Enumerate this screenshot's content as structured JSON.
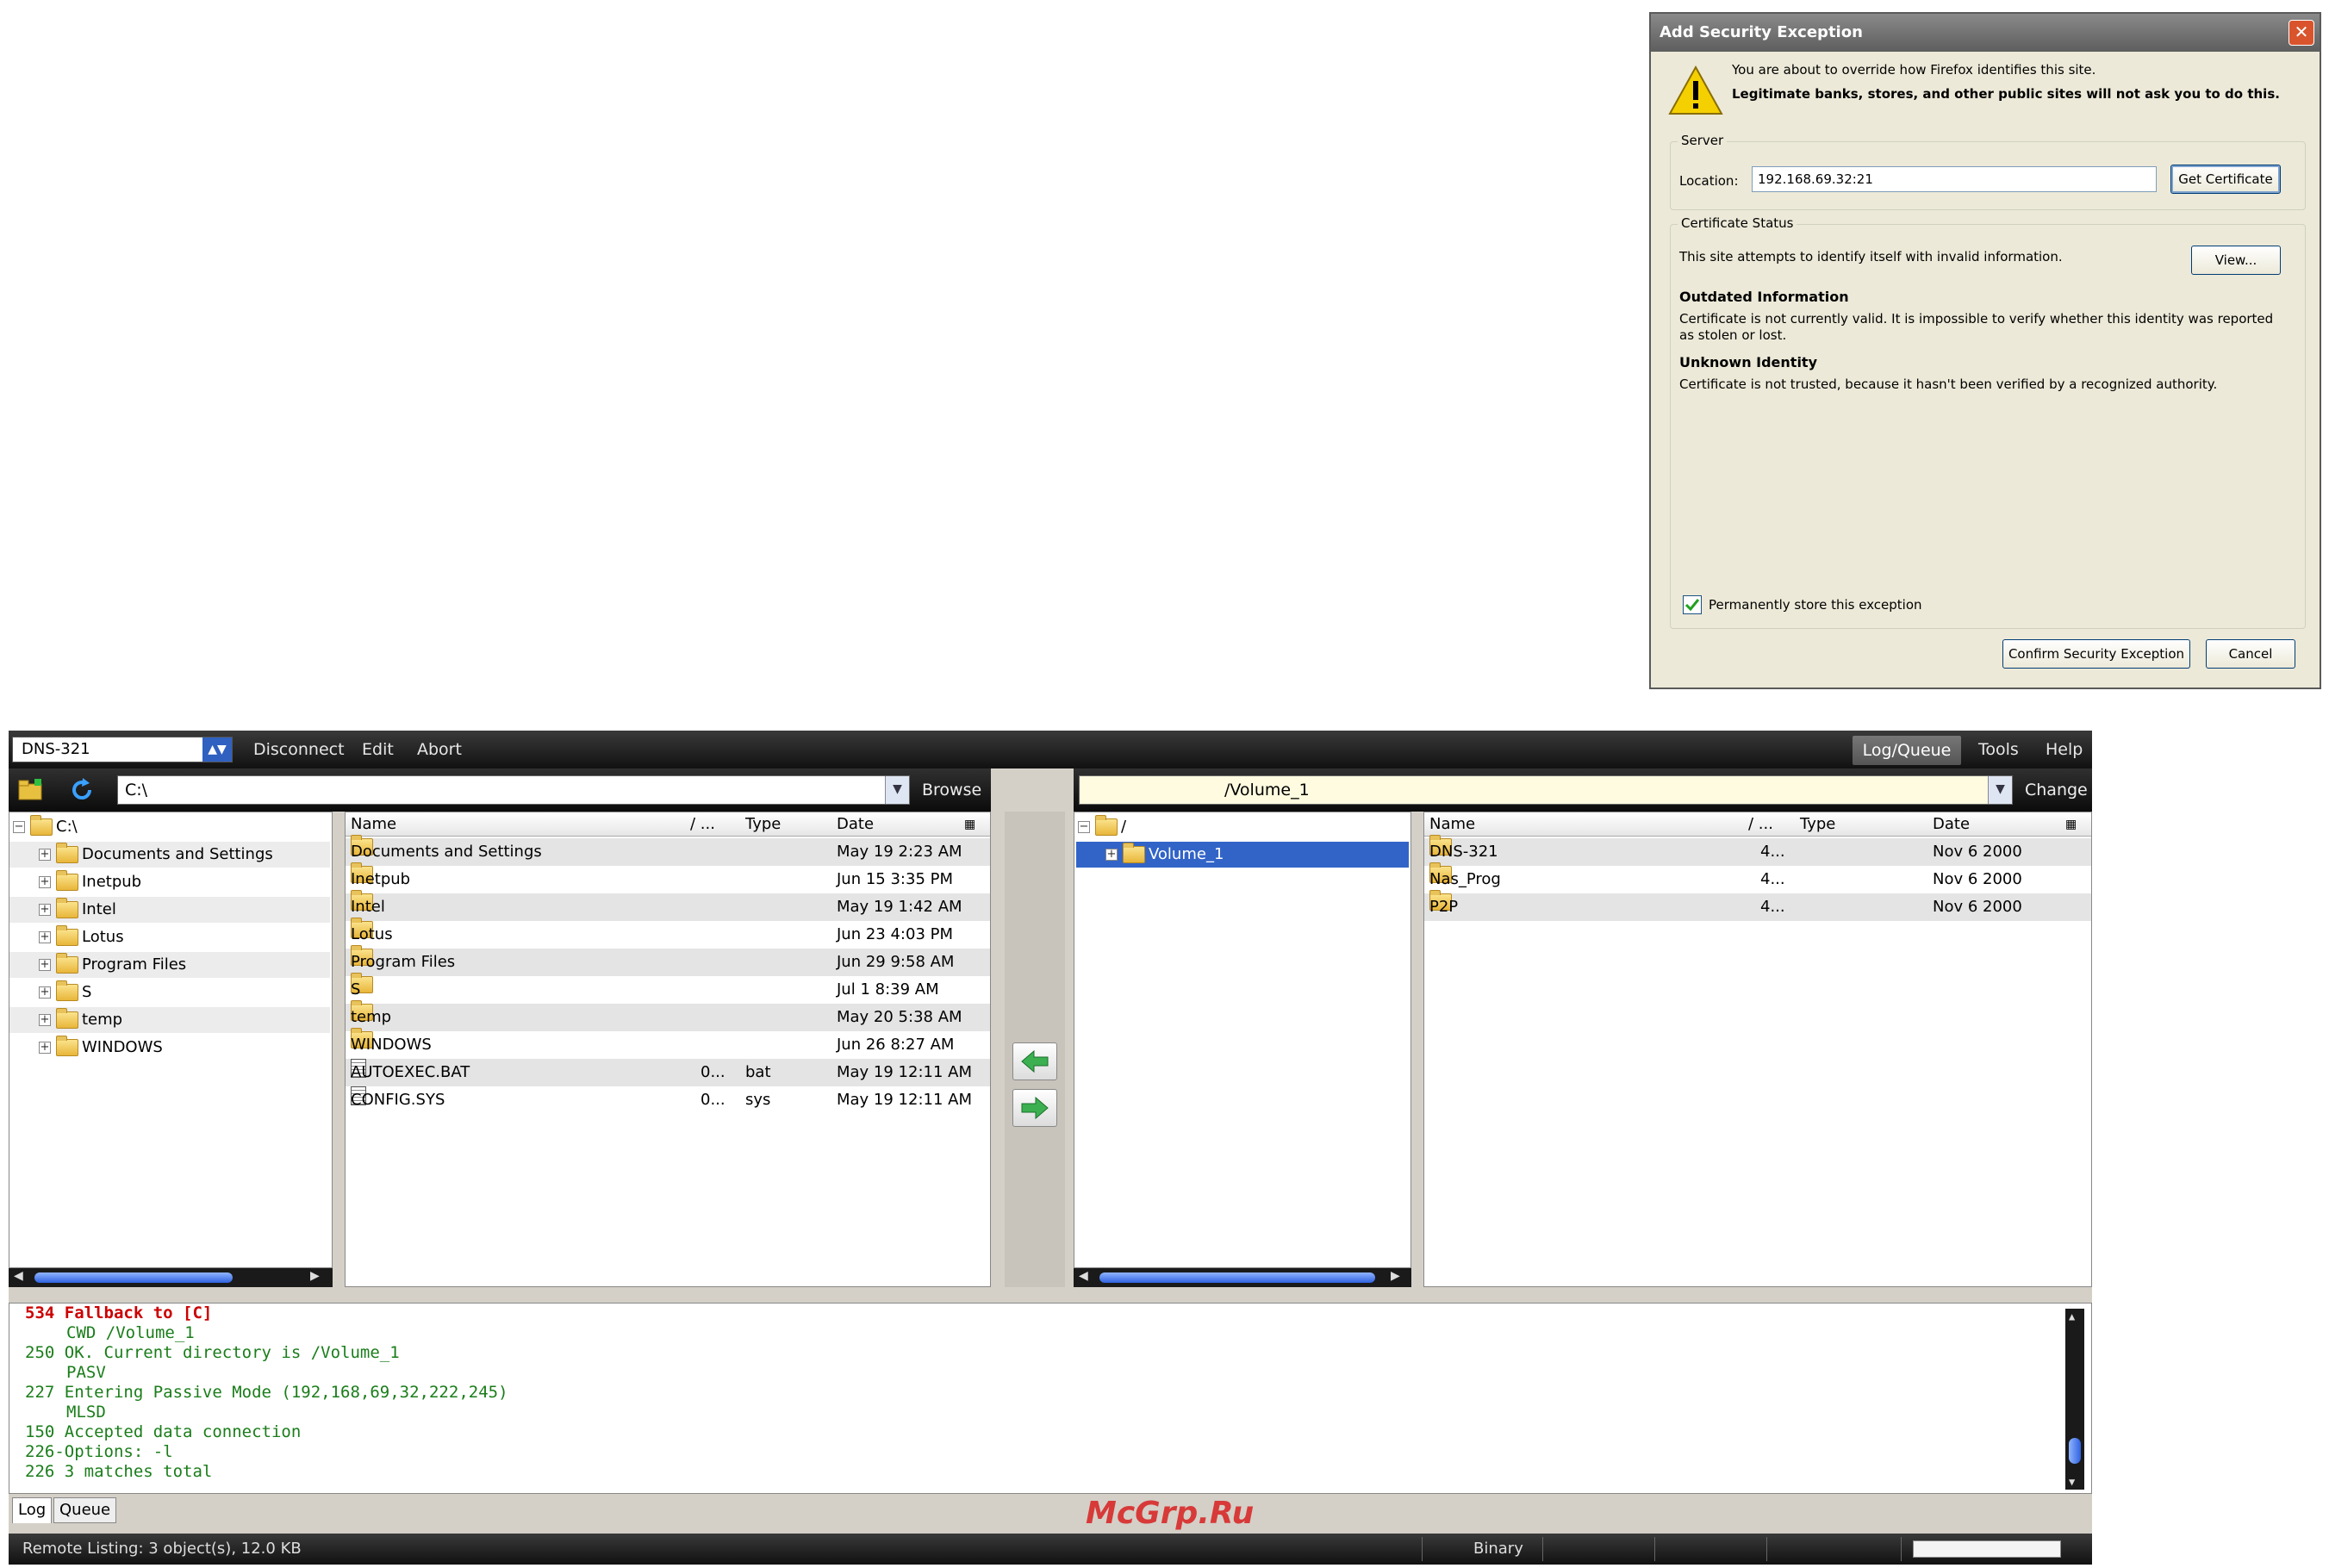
{
  "dialog": {
    "title": "Add Security Exception",
    "intro": "You are about to override how Firefox identifies this site.",
    "warning": "Legitimate banks, stores, and other public sites will not ask you to do this.",
    "server_group": "Server",
    "location_label": "Location:",
    "location_value": "192.168.69.32:21",
    "get_certificate": "Get Certificate",
    "cert_group": "Certificate Status",
    "cert_intro": "This site attempts to identify itself with invalid information.",
    "view_button": "View...",
    "outdated_title": "Outdated Information",
    "outdated_text": "Certificate is not currently valid. It is impossible to verify whether this identity was reported as stolen or lost.",
    "unknown_title": "Unknown Identity",
    "unknown_text": "Certificate is not trusted, because it hasn't been verified by a recognized authority.",
    "permanent_label": "Permanently store this exception",
    "confirm_button": "Confirm Security Exception",
    "cancel_button": "Cancel",
    "colors": {
      "titlebar": "#6e6e6e",
      "close": "#d9542c",
      "body": "#ece9d8"
    }
  },
  "app": {
    "connection": "DNS-321",
    "menu": [
      "Disconnect",
      "Edit",
      "Abort"
    ],
    "right_menu": {
      "active": "Log/Queue",
      "tools": "Tools",
      "help": "Help"
    },
    "local": {
      "path": "C:\\",
      "browse": "Browse",
      "tree_root": "C:\\",
      "tree": [
        "Documents and Settings",
        "Inetpub",
        "Intel",
        "Lotus",
        "Program Files",
        "S",
        "temp",
        "WINDOWS"
      ],
      "columns": {
        "name": "Name",
        "size": "/ ...",
        "type": "Type",
        "date": "Date"
      },
      "files": [
        {
          "name": "Documents and Settings",
          "size": "",
          "type": "",
          "date": "May 19 2:23 AM",
          "kind": "folder"
        },
        {
          "name": "Inetpub",
          "size": "",
          "type": "",
          "date": "Jun 15 3:35 PM",
          "kind": "folder"
        },
        {
          "name": "Intel",
          "size": "",
          "type": "",
          "date": "May 19 1:42 AM",
          "kind": "folder"
        },
        {
          "name": "Lotus",
          "size": "",
          "type": "",
          "date": "Jun 23 4:03 PM",
          "kind": "folder"
        },
        {
          "name": "Program Files",
          "size": "",
          "type": "",
          "date": "Jun 29 9:58 AM",
          "kind": "folder"
        },
        {
          "name": "S",
          "size": "",
          "type": "",
          "date": "Jul 1 8:39 AM",
          "kind": "folder"
        },
        {
          "name": "temp",
          "size": "",
          "type": "",
          "date": "May 20 5:38 AM",
          "kind": "folder"
        },
        {
          "name": "WINDOWS",
          "size": "",
          "type": "",
          "date": "Jun 26 8:27 AM",
          "kind": "folder"
        },
        {
          "name": "AUTOEXEC.BAT",
          "size": "0...",
          "type": "bat",
          "date": "May 19 12:11 AM",
          "kind": "file"
        },
        {
          "name": "CONFIG.SYS",
          "size": "0...",
          "type": "sys",
          "date": "May 19 12:11 AM",
          "kind": "file"
        }
      ]
    },
    "remote": {
      "path": "/Volume_1",
      "change": "Change",
      "tree_root": "/",
      "tree": [
        "Volume_1"
      ],
      "columns": {
        "name": "Name",
        "size": "/ ...",
        "type": "Type",
        "date": "Date"
      },
      "files": [
        {
          "name": "DNS-321",
          "size": "4...",
          "type": "",
          "date": "Nov 6 2000"
        },
        {
          "name": "Nas_Prog",
          "size": "4...",
          "type": "",
          "date": "Nov 6 2000"
        },
        {
          "name": "P2P",
          "size": "4...",
          "type": "",
          "date": "Nov 6 2000"
        }
      ]
    },
    "log": [
      {
        "text": "534 Fallback to [C]",
        "kind": "err"
      },
      {
        "text": "CWD /Volume_1",
        "kind": "cmd"
      },
      {
        "text": "250 OK. Current directory is /Volume_1",
        "kind": "resp"
      },
      {
        "text": "PASV",
        "kind": "cmd"
      },
      {
        "text": "227 Entering Passive Mode (192,168,69,32,222,245)",
        "kind": "resp"
      },
      {
        "text": "MLSD",
        "kind": "cmd"
      },
      {
        "text": "150 Accepted data connection",
        "kind": "resp"
      },
      {
        "text": "226-Options: -l",
        "kind": "resp"
      },
      {
        "text": "226 3 matches total",
        "kind": "resp"
      }
    ],
    "log_tabs": [
      "Log",
      "Queue"
    ],
    "status": {
      "left": "Remote Listing: 3 object(s), 12.0 KB",
      "mode": "Binary"
    }
  },
  "watermark": "McGrp.Ru"
}
